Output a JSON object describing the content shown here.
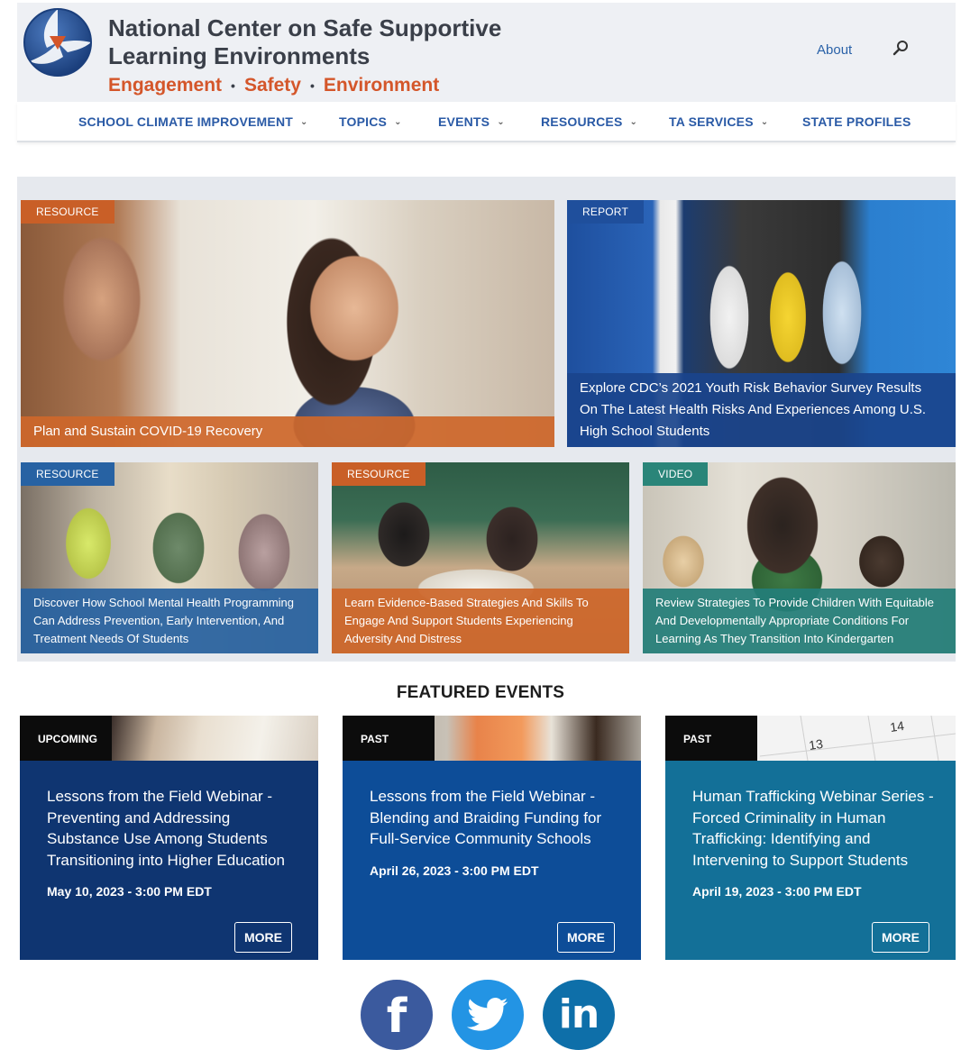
{
  "header": {
    "title_line1": "National Center on Safe Supportive",
    "title_line2": "Learning Environments",
    "tagline": [
      "Engagement",
      "Safety",
      "Environment"
    ],
    "tagline_separator": "•",
    "about": "About",
    "search_icon": "search-icon"
  },
  "nav": {
    "items": [
      {
        "label": "SCHOOL CLIMATE IMPROVEMENT",
        "caret": "⌄"
      },
      {
        "label": "TOPICS",
        "caret": "⌄"
      },
      {
        "label": "EVENTS",
        "caret": "⌄"
      },
      {
        "label": "RESOURCES",
        "caret": "⌄"
      },
      {
        "label": "TA SERVICES",
        "caret": "⌄"
      },
      {
        "label": "STATE PROFILES",
        "caret": ""
      }
    ]
  },
  "featured": {
    "tiles": [
      {
        "badge": "RESOURCE",
        "caption": "Plan and Sustain COVID-19 Recovery"
      },
      {
        "badge": "REPORT",
        "caption": "Explore CDC’s 2021 Youth Risk Behavior Survey Results On The Latest Health Risks And Experiences Among U.S. High School Students"
      },
      {
        "badge": "RESOURCE",
        "caption": "Discover How School Mental Health Programming Can Address Prevention, Early Intervention, And Treatment Needs Of Students"
      },
      {
        "badge": "RESOURCE",
        "caption": "Learn Evidence-Based Strategies And Skills To Engage And Support Students Experiencing Adversity And Distress"
      },
      {
        "badge": "VIDEO",
        "caption": "Review Strategies To Provide Children With Equitable And Developmentally Appropriate Conditions For Learning As They Transition Into Kindergarten"
      }
    ]
  },
  "events": {
    "heading": "FEATURED EVENTS",
    "cards": [
      {
        "status": "UPCOMING",
        "title": "Lessons from the Field Webinar - Preventing and Addressing Substance Use Among Students Transitioning into Higher Education",
        "date": "May 10, 2023 - 3:00 PM EDT",
        "more": "MORE"
      },
      {
        "status": "PAST",
        "title": "Lessons from the Field Webinar - Blending and Braiding Funding for Full-Service Community Schools",
        "date": "April 26, 2023 - 3:00 PM EDT",
        "more": "MORE"
      },
      {
        "status": "PAST",
        "title": "Human Trafficking Webinar Series - Forced Criminality in Human Trafficking: Identifying and Intervening to Support Students",
        "date": "April 19, 2023 - 3:00 PM EDT",
        "more": "MORE"
      }
    ],
    "calendar_numbers": [
      "13",
      "14"
    ]
  },
  "social": {
    "facebook": "f",
    "linkedin": "in"
  },
  "colors": {
    "brand_orange": "#d4562a",
    "brand_blue": "#2a5aa6",
    "event_dark": "#0f3571",
    "event_mid": "#0d4d98",
    "event_teal": "#137098"
  }
}
